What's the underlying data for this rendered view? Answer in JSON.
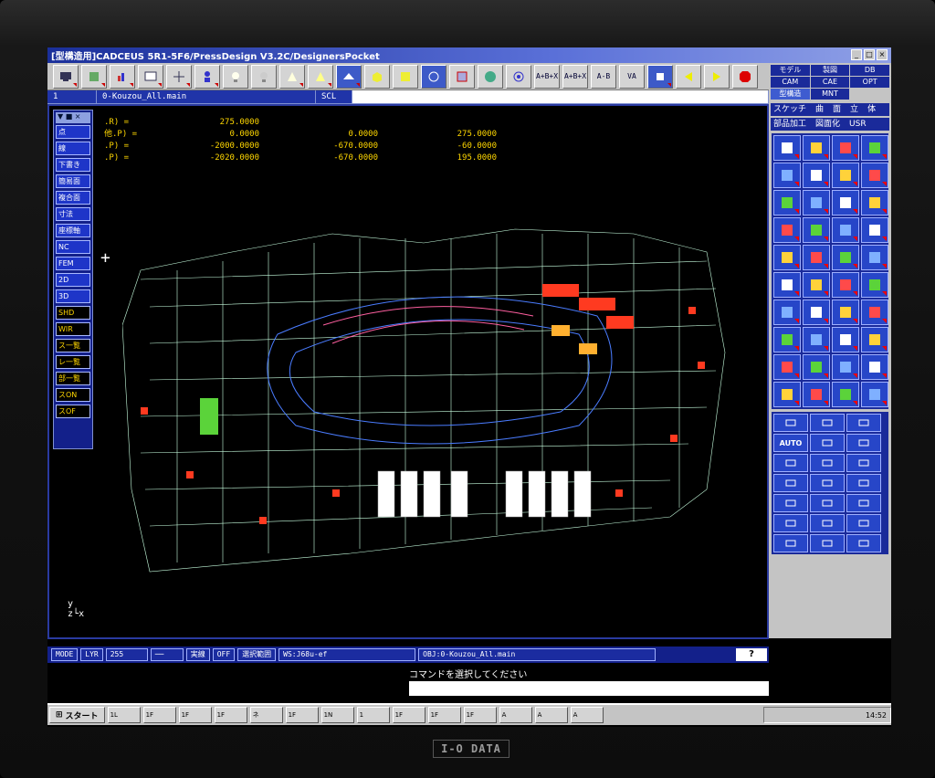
{
  "window": {
    "title": "[型構造用]CADCEUS 5R1-5F6/PressDesign V3.2C/DesignersPocket",
    "min": "_",
    "max": "□",
    "close": "×"
  },
  "toolbar": {
    "buttons": [
      "A+B+X",
      "A+B+X",
      "A-B",
      "VA",
      "STOP"
    ]
  },
  "tabs": {
    "index": "1",
    "file": "0-Kouzou_All.main",
    "mode": "SCL"
  },
  "coords": [
    {
      "label": ".R) =",
      "v1": "275.0000",
      "v2": "",
      "v3": ""
    },
    {
      "label": "他.P) =",
      "v1": "0.0000",
      "v2": "0.0000",
      "v3": "275.0000"
    },
    {
      "label": ".P) =",
      "v1": "-2000.0000",
      "v2": "-670.0000",
      "v3": "-60.0000"
    },
    {
      "label": ".P) =",
      "v1": "-2020.0000",
      "v2": "-670.0000",
      "v3": "195.0000"
    }
  ],
  "left_menu": {
    "items": [
      {
        "label": "点",
        "highlight": false
      },
      {
        "label": "線",
        "highlight": false
      },
      {
        "label": "下書き",
        "highlight": false
      },
      {
        "label": "簡易面",
        "highlight": false
      },
      {
        "label": "複合面",
        "highlight": false
      },
      {
        "label": "寸法",
        "highlight": false
      },
      {
        "label": "座標軸",
        "highlight": false
      },
      {
        "label": "NC",
        "highlight": false
      },
      {
        "label": "FEM",
        "highlight": false
      },
      {
        "label": "2D",
        "highlight": false
      },
      {
        "label": "3D",
        "highlight": false
      },
      {
        "label": "SHD",
        "highlight": true
      },
      {
        "label": "WIR",
        "highlight": true
      },
      {
        "label": "ス一覧",
        "highlight": true
      },
      {
        "label": "レ一覧",
        "highlight": true
      },
      {
        "label": "部一覧",
        "highlight": true
      },
      {
        "label": "スON",
        "highlight": true
      },
      {
        "label": "スOF",
        "highlight": true
      }
    ]
  },
  "right_panel": {
    "tabs": [
      "モデル",
      "製図",
      "DB",
      "CAM",
      "CAE",
      "OPT",
      "型構造",
      "MNT"
    ],
    "selected_tab": "型構造",
    "section1": [
      "スケッチ",
      "曲",
      "面",
      "立",
      "体"
    ],
    "section2": [
      "部品加工",
      "図面化",
      "USR"
    ],
    "icons": [
      "new-doc",
      "chart",
      "save",
      "open",
      "folder",
      "zoom",
      "part",
      "shape",
      "mesh",
      "wave",
      "tool",
      "vrml",
      "gear",
      "grid",
      "box",
      "target",
      "measure",
      "cube",
      "check",
      "solid",
      "book",
      "jig",
      "arrow",
      "key",
      "plate",
      "frame",
      "label",
      "cone",
      "bolt",
      "spr",
      "wing",
      "image",
      "wave2",
      "copy",
      "move",
      "mirror",
      "rotate",
      "scale",
      "layer",
      "stack"
    ],
    "icons2": [
      "rect",
      "link",
      "gear2",
      "AUTO",
      "cross",
      "line",
      "curve",
      "dash",
      "box2",
      "search",
      "window",
      "view",
      "grid2",
      "rot",
      "rot2",
      "xyz",
      "xyz2",
      "table",
      "x-axis",
      "y-axis",
      "sun"
    ]
  },
  "status": {
    "mode": "MODE",
    "layer": "LYR",
    "num": "255",
    "s1": "実線",
    "s2": "OFF",
    "s3": "選択範囲",
    "ws": "WS:J68u-ef",
    "obj": "OBJ:0-Kouzou_All.main",
    "help": "?"
  },
  "command": {
    "prompt": "コマンドを選択してください"
  },
  "taskbar": {
    "start": "スタート",
    "items": [
      "1L",
      "1F",
      "1F",
      "1F",
      "ネ",
      "1F",
      "1N",
      "1",
      "1F",
      "1F",
      "1F",
      "A",
      "A",
      "A"
    ],
    "tray": "14:52"
  },
  "bezel": {
    "brand": "I-O DATA"
  },
  "axis": {
    "x": "x",
    "y": "y",
    "z": "z"
  }
}
